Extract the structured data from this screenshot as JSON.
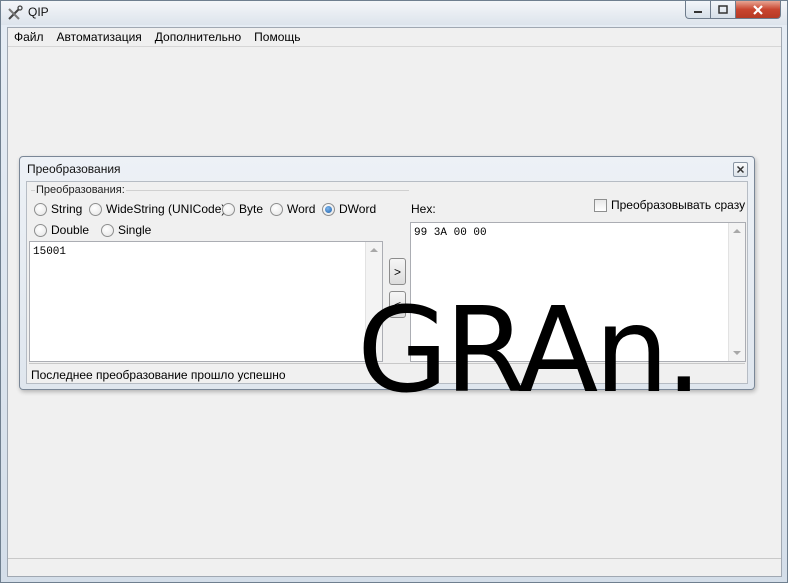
{
  "window": {
    "title": "QIP",
    "app_icon": "tools-icon"
  },
  "menu": [
    "Файл",
    "Автоматизация",
    "Дополнительно",
    "Помощь"
  ],
  "dialog": {
    "title": "Преобразования",
    "group_label": "Преобразования:",
    "radios": [
      {
        "label": "String",
        "selected": false
      },
      {
        "label": "WideString (UNICode)",
        "selected": false
      },
      {
        "label": "Byte",
        "selected": false
      },
      {
        "label": "Word",
        "selected": false
      },
      {
        "label": "DWord",
        "selected": true
      },
      {
        "label": "Double",
        "selected": false
      },
      {
        "label": "Single",
        "selected": false
      }
    ],
    "hex_label": "Hex:",
    "convert_checkbox_label": "Преобразовывать сразу",
    "input_value": "15001",
    "hex_value": "99 3A 00 00",
    "to_hex_button": ">",
    "from_hex_button": "<",
    "status": "Последнее преобразование прошло успешно"
  },
  "watermark": "GRAn."
}
